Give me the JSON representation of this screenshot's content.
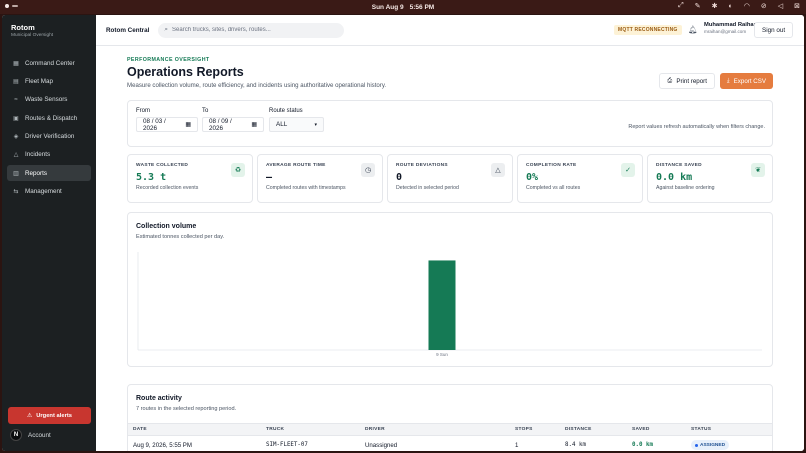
{
  "menubar": {
    "date": "Sun Aug 9",
    "time": "5:56 PM"
  },
  "sidebar": {
    "brand": "Rotom",
    "brand_sub": "Municipal Oversight",
    "items": [
      {
        "label": "Command Center",
        "icon": "grid-icon",
        "active": false
      },
      {
        "label": "Fleet Map",
        "icon": "map-icon",
        "active": false
      },
      {
        "label": "Waste Sensors",
        "icon": "sensor-icon",
        "active": false
      },
      {
        "label": "Routes & Dispatch",
        "icon": "route-icon",
        "active": false
      },
      {
        "label": "Driver Verification",
        "icon": "shield-icon",
        "active": false
      },
      {
        "label": "Incidents",
        "icon": "alert-icon",
        "active": false
      },
      {
        "label": "Reports",
        "icon": "bar-chart-icon",
        "active": true
      },
      {
        "label": "Management",
        "icon": "sliders-icon",
        "active": false
      }
    ],
    "urgent_label": "Urgent alerts",
    "account_label": "Account",
    "avatar_initial": "N"
  },
  "topbar": {
    "org": "Rotom Central",
    "search_placeholder": "Search trucks, sites, drivers, routes...",
    "mqtt_status": "MQTT RECONNECTING",
    "user_name": "Muhammad Raihan",
    "user_email": "mraihan@gmail.com",
    "signout": "Sign out"
  },
  "page": {
    "eyebrow": "PERFORMANCE OVERSIGHT",
    "title": "Operations Reports",
    "subtitle": "Measure collection volume, route efficiency, and incidents using authoritative operational history.",
    "print_label": "Print report",
    "export_label": "Export CSV"
  },
  "filters": {
    "from_label": "From",
    "from_value": "08 / 03 / 2026",
    "to_label": "To",
    "to_value": "08 / 09 / 2026",
    "status_label": "Route status",
    "status_value": "ALL",
    "note": "Report values refresh automatically when filters change."
  },
  "cards": [
    {
      "label": "WASTE COLLECTED",
      "value": "5.3 t",
      "hint": "Recorded collection events",
      "icon": "recycle-icon"
    },
    {
      "label": "AVERAGE ROUTE TIME",
      "value": "—",
      "hint": "Completed routes with timestamps",
      "icon": "clock-icon"
    },
    {
      "label": "ROUTE DEVIATIONS",
      "value": "0",
      "hint": "Detected in selected period",
      "icon": "warning-icon"
    },
    {
      "label": "COMPLETION RATE",
      "value": "0%",
      "hint": "Completed vs all routes",
      "icon": "check-circle-icon"
    },
    {
      "label": "DISTANCE SAVED",
      "value": "0.0 km",
      "hint": "Against baseline ordering",
      "icon": "leaf-icon"
    }
  ],
  "chart": {
    "title": "Collection volume",
    "subtitle": "Estimated tonnes collected per day."
  },
  "chart_data": {
    "type": "bar",
    "categories": [
      "9 Sun"
    ],
    "values": [
      5.3
    ],
    "ylim": [
      0,
      5.8
    ],
    "color": "#157a55",
    "grid": false
  },
  "activity": {
    "title": "Route activity",
    "subtitle": "7 routes in the selected reporting period.",
    "columns": [
      "DATE",
      "TRUCK",
      "DRIVER",
      "STOPS",
      "DISTANCE",
      "SAVED",
      "STATUS"
    ],
    "rows": [
      {
        "date": "Aug 9, 2026, 5:55 PM",
        "truck": "SIM-FLEET-07",
        "driver": "Unassigned",
        "stops": "1",
        "distance": "8.4 km",
        "saved": "0.0 km",
        "status": "ASSIGNED"
      }
    ]
  },
  "colors": {
    "accent": "#157a55",
    "export": "#e57c3f",
    "urgent": "#c8362f",
    "sidebar": "#1c2022"
  }
}
